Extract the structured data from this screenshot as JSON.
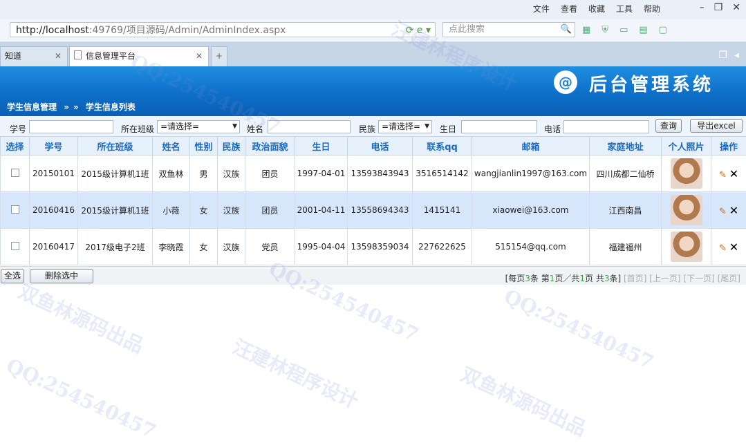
{
  "browser": {
    "menu": [
      "文件",
      "查看",
      "收藏",
      "工具",
      "帮助"
    ],
    "url_host": "http://localhost",
    "url_path": ":49769/项目源码/Admin/AdminIndex.aspx",
    "search_placeholder": "点此搜索",
    "tabs": [
      {
        "label": "知道"
      },
      {
        "label": "信息管理平台"
      }
    ]
  },
  "app": {
    "system_title": "后台管理系统",
    "breadcrumb": [
      "学生信息管理",
      "»",
      "»",
      "学生信息列表"
    ]
  },
  "filter": {
    "student_id_label": "学号",
    "class_label": "所在班级",
    "class_value": "=请选择=",
    "name_label": "姓名",
    "ethnicity_label": "民族",
    "ethnicity_value": "=请选择=",
    "birthday_label": "生日",
    "phone_label": "电话",
    "query_button": "查询",
    "export_button": "导出excel"
  },
  "table": {
    "headers": [
      "选择",
      "学号",
      "所在班级",
      "姓名",
      "性别",
      "民族",
      "政治面貌",
      "生日",
      "电话",
      "联系qq",
      "邮箱",
      "家庭地址",
      "个人照片",
      "操作"
    ],
    "rows": [
      {
        "id": "20150101",
        "class": "2015级计算机1班",
        "name": "双鱼林",
        "gender": "男",
        "ethnicity": "汉族",
        "political": "团员",
        "birthday": "1997-04-01",
        "phone": "13593843943",
        "qq": "3516514142",
        "email": "wangjianlin1997@163.com",
        "address": "四川成都二仙桥"
      },
      {
        "id": "20160416",
        "class": "2015级计算机1班",
        "name": "小薇",
        "gender": "女",
        "ethnicity": "汉族",
        "political": "团员",
        "birthday": "2001-04-11",
        "phone": "13558694343",
        "qq": "1415141",
        "email": "xiaowei@163.com",
        "address": "江西南昌"
      },
      {
        "id": "20160417",
        "class": "2017级电子2班",
        "name": "李晓霞",
        "gender": "女",
        "ethnicity": "汉族",
        "political": "党员",
        "birthday": "1995-04-04",
        "phone": "13598359034",
        "qq": "227622625",
        "email": "515154@qq.com",
        "address": "福建福州"
      }
    ]
  },
  "pager": {
    "select_all": "全选",
    "delete_selected": "删除选中",
    "per_page_prefix": "[每页",
    "per_page": "3",
    "per_page_suffix": "条 第",
    "current_page": "1",
    "page_mid": "页／共",
    "total_pages": "1",
    "page_suffix": "页 共",
    "total_records": "3",
    "records_suffix": "条]",
    "first": "[首页]",
    "prev": "[上一页]",
    "next": "[下一页]",
    "last": "[尾页]"
  },
  "watermarks": {
    "qq": "QQ:254540457",
    "author": "双鱼林源码出品",
    "design": "汪建林程序设计"
  }
}
